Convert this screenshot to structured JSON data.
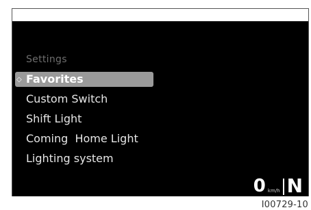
{
  "menu": {
    "title": "Settings",
    "items": [
      {
        "label": "Favorites",
        "selected": true
      },
      {
        "label": "Custom Switch",
        "selected": false
      },
      {
        "label": "Shift Light",
        "selected": false
      },
      {
        "label": "Coming  Home Light",
        "selected": false
      },
      {
        "label": "Lighting system",
        "selected": false
      }
    ]
  },
  "status": {
    "speed": "0",
    "speed_unit": "km/h",
    "gear": "N"
  },
  "caption": "I00729-10",
  "icons": {
    "selected_marker": "diamond-outline-icon"
  },
  "colors": {
    "screen_bg": "#000000",
    "highlight": "#9a9a9a",
    "text": "#e6e6e6",
    "title": "#6e6e6e"
  }
}
